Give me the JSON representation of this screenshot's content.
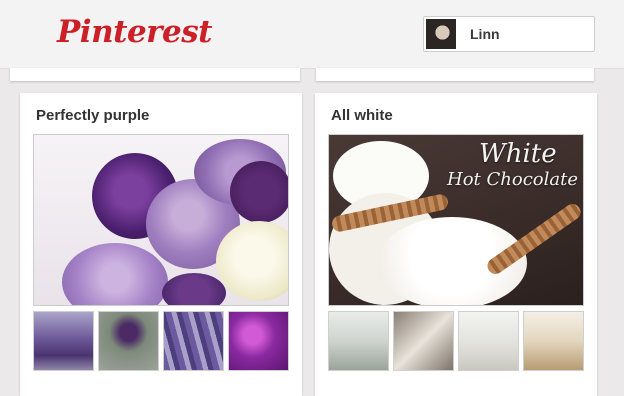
{
  "header": {
    "logo_text": "Pinterest",
    "logo_color": "#cb2027",
    "user": {
      "name": "Linn"
    }
  },
  "boards": [
    {
      "title": "Perfectly purple",
      "cover_image": "purple and white roses bouquet",
      "thumbnails": [
        "purple lavender field",
        "purple flower bud",
        "lavender sprigs",
        "purple orchid blossoms"
      ]
    },
    {
      "title": "All white",
      "cover_image": "white hot chocolate with whipped cream",
      "cover_text": [
        "White",
        "Hot Chocolate"
      ],
      "thumbnails": [
        "white dining room",
        "white rustic kitchen",
        "white living room",
        "white interior shelves"
      ]
    }
  ]
}
